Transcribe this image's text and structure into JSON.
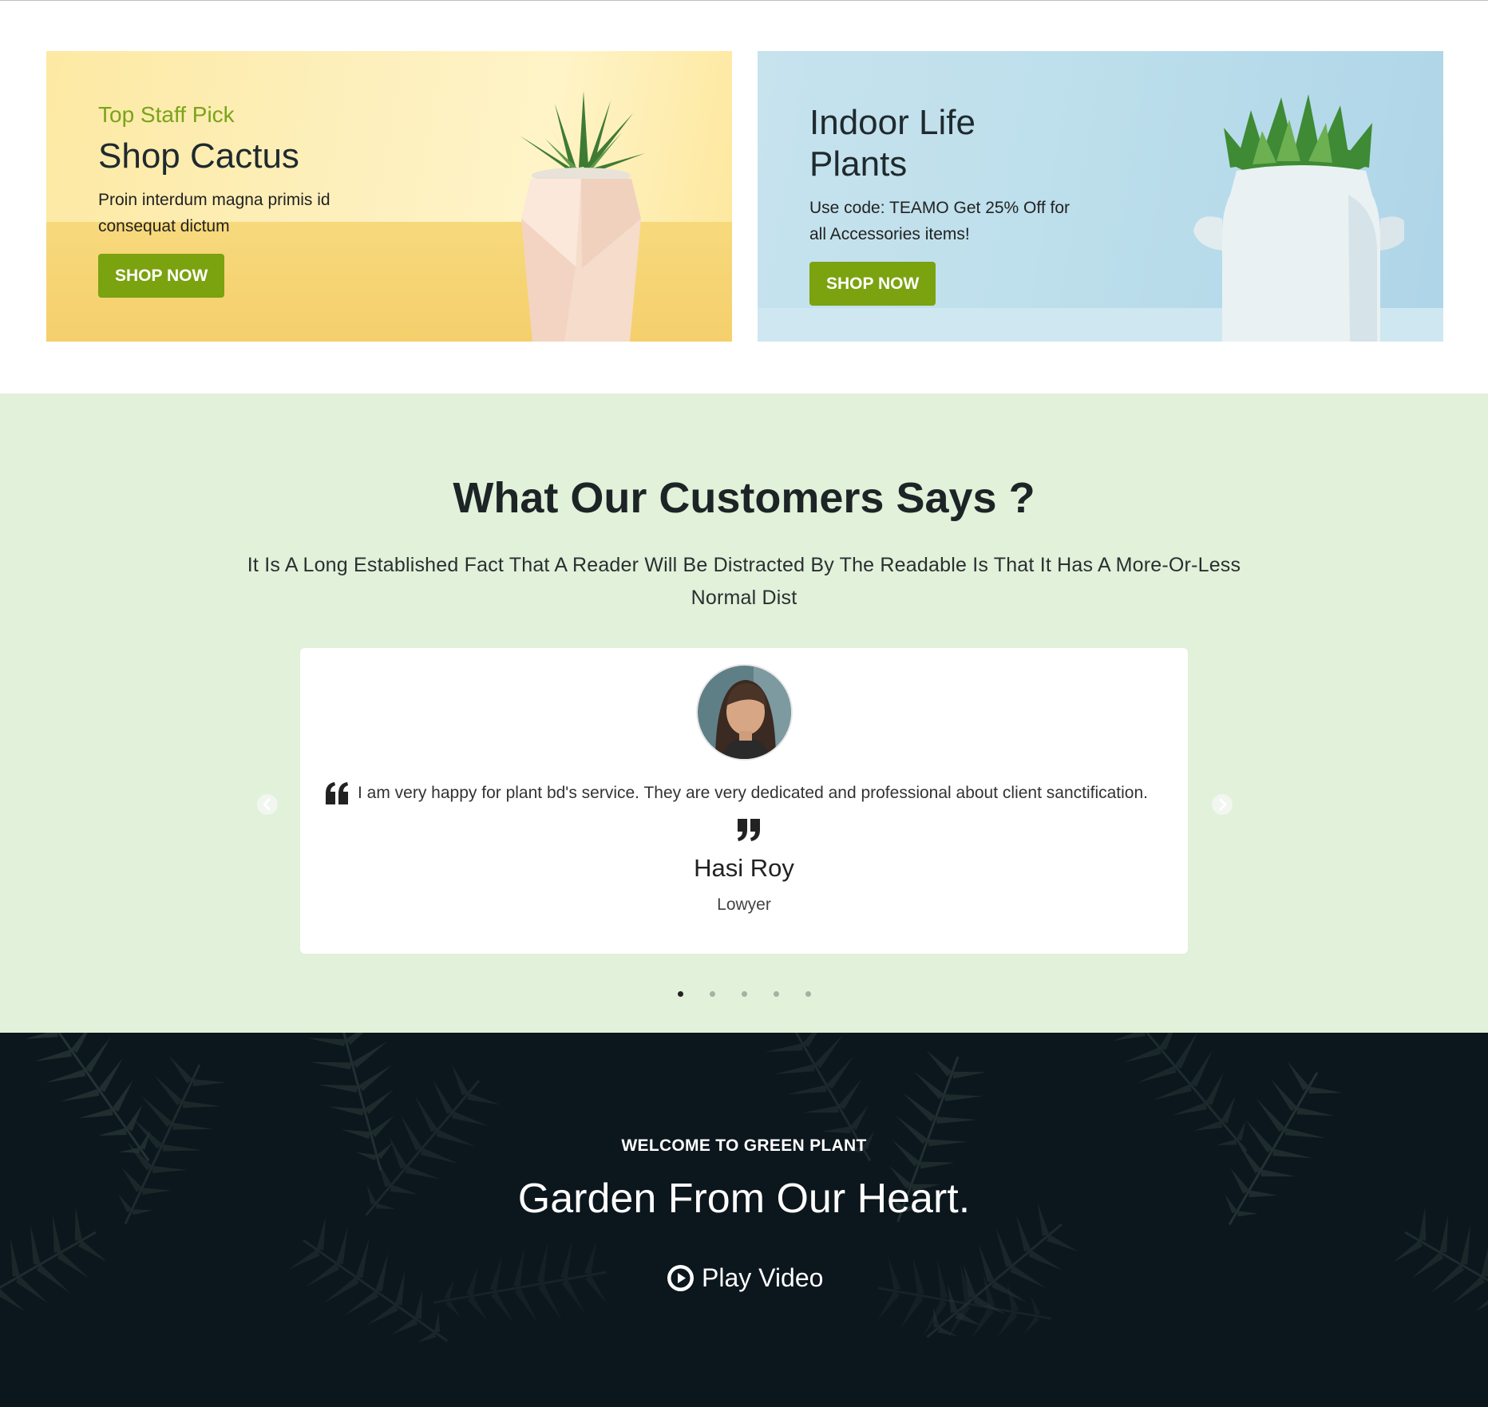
{
  "promos": [
    {
      "eyebrow": "Top Staff Pick",
      "title": "Shop Cactus",
      "description": "Proin interdum magna primis id consequat dictum",
      "button": "SHOP NOW"
    },
    {
      "eyebrow": "",
      "title": "Indoor Life Plants",
      "description": "Use code: TEAMO Get 25% Off for all Accessories items!",
      "button": "SHOP NOW"
    }
  ],
  "testimonials": {
    "title": "What Our Customers Says ?",
    "subtitle": "It Is A Long Established Fact That A Reader Will Be Distracted By The Readable Is That It Has A More-Or-Less Normal Dist",
    "current": {
      "quote": "I am very happy for plant bd's service. They are very dedicated and professional about client sanctification.",
      "name": "Hasi Roy",
      "role": "Lowyer"
    },
    "slide_count": 5,
    "active_slide": 1
  },
  "hero": {
    "welcome": "WELCOME TO GREEN PLANT",
    "title": "Garden From Our Heart.",
    "play_label": "Play Video"
  },
  "colors": {
    "accent_green": "#7ba20f",
    "testimonial_bg": "#e1f1da",
    "hero_bg": "#0c161d"
  }
}
